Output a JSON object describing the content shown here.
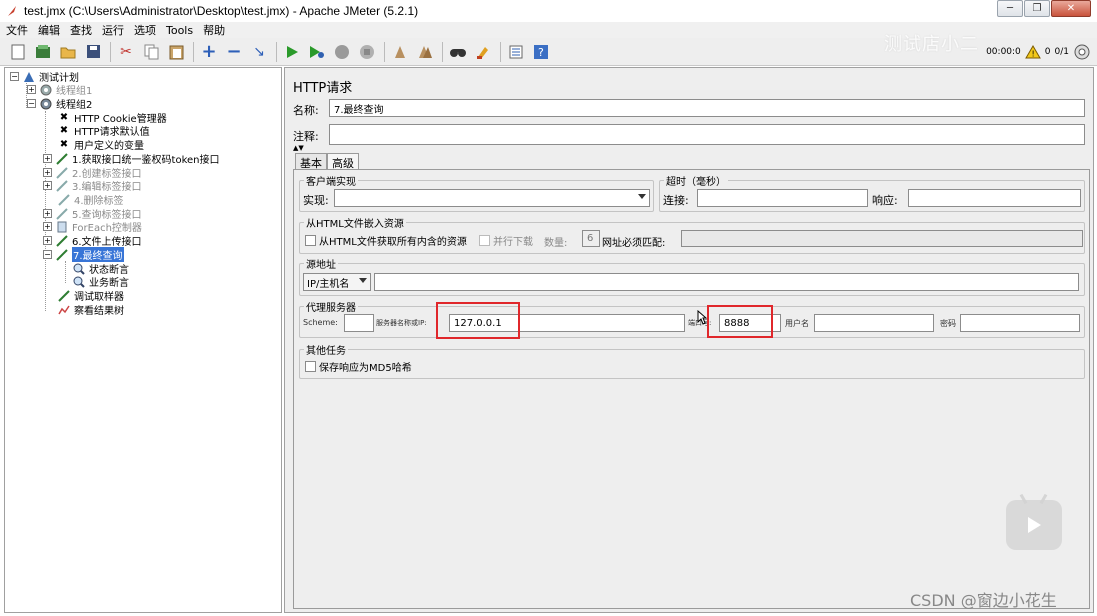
{
  "window": {
    "title": "test.jmx (C:\\Users\\Administrator\\Desktop\\test.jmx) - Apache JMeter (5.2.1)"
  },
  "menu": [
    "文件",
    "编辑",
    "查找",
    "运行",
    "选项",
    "Tools",
    "帮助"
  ],
  "toolbar": {
    "timer": "00:00:0",
    "warnings": "0",
    "threads": "0/1"
  },
  "watermark": "测试店小二",
  "tree": {
    "items": [
      {
        "label": "测试计划"
      },
      {
        "label": "线程组1"
      },
      {
        "label": "线程组2"
      },
      {
        "label": "HTTP Cookie管理器"
      },
      {
        "label": "HTTP请求默认值"
      },
      {
        "label": "用户定义的变量"
      },
      {
        "label": "1.获取接口统一鉴权码token接口"
      },
      {
        "label": "2.创建标签接口"
      },
      {
        "label": "3.编辑标签接口"
      },
      {
        "label": "4.删除标签"
      },
      {
        "label": "5.查询标签接口"
      },
      {
        "label": "ForEach控制器"
      },
      {
        "label": "6.文件上传接口"
      },
      {
        "label": "7.最终查询"
      },
      {
        "label": "状态断言"
      },
      {
        "label": "业务断言"
      },
      {
        "label": "调试取样器"
      },
      {
        "label": "察看结果树"
      }
    ]
  },
  "panel": {
    "title": "HTTP请求",
    "name_label": "名称:",
    "name_value": "7.最终查询",
    "comment_label": "注释:",
    "tabs": [
      "基本",
      "高级"
    ],
    "client": {
      "title": "客户端实现",
      "impl_label": "实现:"
    },
    "timeout": {
      "title": "超时（毫秒）",
      "connect_label": "连接:",
      "response_label": "响应:"
    },
    "embedded": {
      "title": "从HTML文件嵌入资源",
      "retrieve_label": "从HTML文件获取所有内含的资源",
      "parallel_label": "并行下载",
      "count_label": "数量:",
      "count_value": "6",
      "url_match_label": "网址必须匹配:"
    },
    "source": {
      "title": "源地址",
      "type_value": "IP/主机名"
    },
    "proxy": {
      "title": "代理服务器",
      "scheme_label": "Scheme:",
      "host_label": "服务器名称或IP:",
      "host_value": "127.0.0.1",
      "port_label": "端口号:",
      "port_value": "8888",
      "user_label": "用户名",
      "password_label": "密码"
    },
    "other": {
      "title": "其他任务",
      "md5_label": "保存响应为MD5哈希"
    }
  },
  "overlay": {
    "csdn": "CSDN @窗边小花生"
  }
}
